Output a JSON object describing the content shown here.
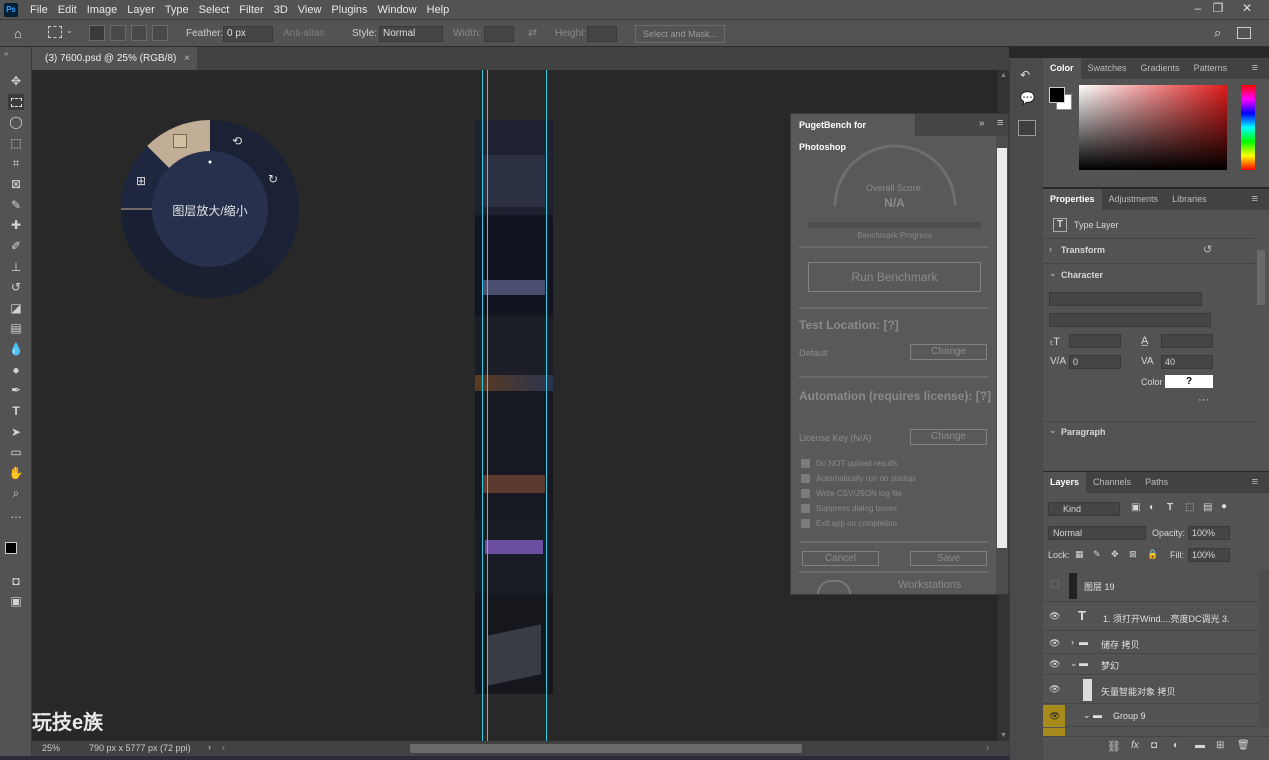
{
  "menubar": {
    "app_icon": "Ps",
    "items": [
      "File",
      "Edit",
      "Image",
      "Layer",
      "Type",
      "Select",
      "Filter",
      "3D",
      "View",
      "Plugins",
      "Window",
      "Help"
    ]
  },
  "options": {
    "feather_label": "Feather:",
    "feather_value": "0 px",
    "antialias": "Anti-alias",
    "style_label": "Style:",
    "style_value": "Normal",
    "width_label": "Width:",
    "height_label": "Height:",
    "select_mask": "Select and Mask..."
  },
  "document": {
    "tab_title": "(3)  7600.psd @ 25% (RGB/8)",
    "zoom": "25%",
    "doc_info": "790 px x 5777 px (72 ppi)"
  },
  "radial": {
    "center_label": "图层放大/缩小"
  },
  "watermark": "玩技e族",
  "puget": {
    "title": "PugetBench for Photoshop",
    "overall_label": "Overall Score:",
    "overall_value": "N/A",
    "progress_label": "Benchmark Progress",
    "run_btn": "Run Benchmark",
    "test_location": "Test Location: [?]",
    "location_value": "Default",
    "change": "Change",
    "automation": "Automation (requires license): [?]",
    "license_key": "License Key (N/A)",
    "checkboxes": [
      "Do NOT upload results",
      "Automatically run on startup",
      "Write CSV/JSON log file",
      "Suppress dialog boxes",
      "Exit app on completion"
    ],
    "cancel": "Cancel",
    "save": "Save",
    "footer_text": "Workstations"
  },
  "color_tabs": [
    "Color",
    "Swatches",
    "Gradients",
    "Patterns"
  ],
  "props_tabs": [
    "Properties",
    "Adjustments",
    "Libraries"
  ],
  "properties": {
    "type_layer": "Type Layer",
    "transform": "Transform",
    "character": "Character",
    "leading_value": "0",
    "tracking_value": "40",
    "color_label": "Color",
    "color_value": "?",
    "paragraph": "Paragraph"
  },
  "layers_tabs": [
    "Layers",
    "Channels",
    "Paths"
  ],
  "layers": {
    "kind": "Kind",
    "blend": "Normal",
    "opacity_label": "Opacity:",
    "opacity": "100%",
    "lock_label": "Lock:",
    "fill_label": "Fill:",
    "fill": "100%",
    "rows": [
      "图层 19",
      "1. 须打开Wind....亮度DC调光 3.",
      "储存 拷贝",
      "梦幻",
      "矢量智能对象 拷贝",
      "Group 9"
    ]
  },
  "colors": {
    "accent": "#31a8ff",
    "guide": "#36c9e0",
    "radial_dark": "#1b2236",
    "radial_highlight": "#c2ad96"
  }
}
